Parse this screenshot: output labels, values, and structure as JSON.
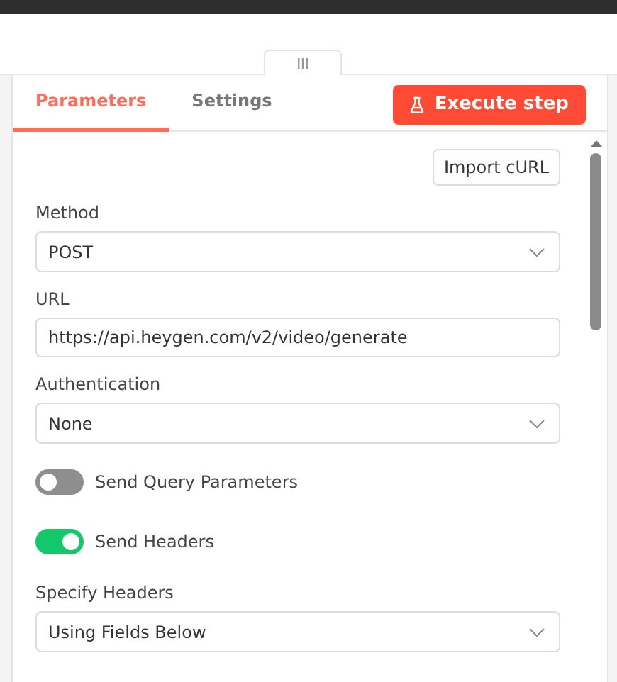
{
  "tabs": [
    {
      "label": "Parameters",
      "selected": true
    },
    {
      "label": "Settings",
      "selected": false
    }
  ],
  "execute_button": "Execute step",
  "import_button": "Import cURL",
  "fields": [
    {
      "kind": "select",
      "label": "Method",
      "value": "POST"
    },
    {
      "kind": "input",
      "label": "URL",
      "value": "https://api.heygen.com/v2/video/generate"
    },
    {
      "kind": "select",
      "label": "Authentication",
      "value": "None"
    },
    {
      "kind": "toggle",
      "label": "Send Query Parameters",
      "on": false
    },
    {
      "kind": "toggle",
      "label": "Send Headers",
      "on": true
    },
    {
      "kind": "select",
      "label": "Specify Headers",
      "value": "Using Fields Below"
    }
  ]
}
